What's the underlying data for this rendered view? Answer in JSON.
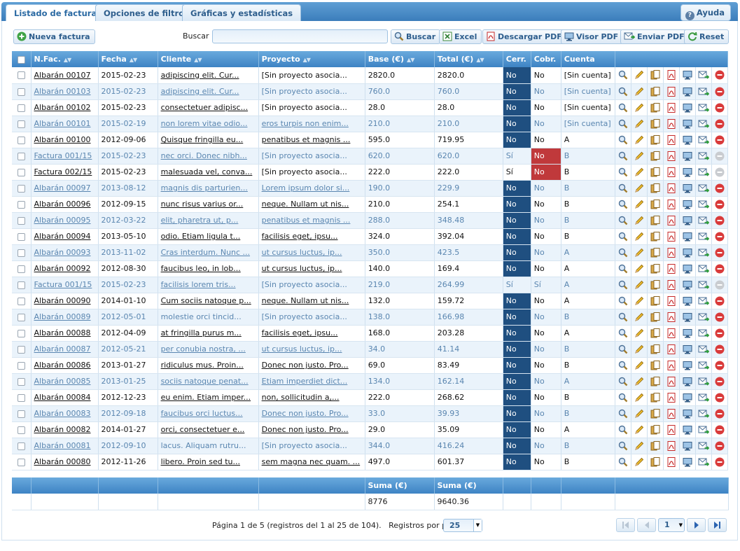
{
  "tabs": [
    {
      "label": "Listado de facturas",
      "active": true
    },
    {
      "label": "Opciones de filtro",
      "active": false
    },
    {
      "label": "Gráficas y estadísticas",
      "active": false
    }
  ],
  "help_label": "Ayuda",
  "toolbar": {
    "new_invoice": "Nueva factura",
    "search_label": "Buscar",
    "search_value": "",
    "search_button": "Buscar",
    "excel": "Excel",
    "download_pdf": "Descargar PDF",
    "viewer_pdf": "Visor PDF",
    "send_pdf": "Enviar PDF",
    "reset": "Reset"
  },
  "columns": {
    "nfac": "N.Fac.",
    "fecha": "Fecha",
    "cliente": "Cliente",
    "proyecto": "Proyecto",
    "base": "Base (€)",
    "total": "Total (€)",
    "cerr": "Cerr.",
    "cobr": "Cobr.",
    "cuenta": "Cuenta"
  },
  "rows": [
    {
      "nfac": "Albarán 00107",
      "fecha": "2015-02-23",
      "cliente": "adipiscing elit. Cur...",
      "proyecto": "[Sin proyecto asocia...",
      "base": "2820.0",
      "total": "2820.0",
      "cerr": "No",
      "cobr": "No",
      "cuenta": "[Sin cuenta]"
    },
    {
      "nfac": "Albarán 00103",
      "fecha": "2015-02-23",
      "cliente": "adipiscing elit. Cur...",
      "proyecto": "[Sin proyecto asocia...",
      "base": "760.0",
      "total": "760.0",
      "cerr": "No",
      "cobr": "No",
      "cuenta": "[Sin cuenta]"
    },
    {
      "nfac": "Albarán 00102",
      "fecha": "2015-02-23",
      "cliente": "consectetuer adipisc...",
      "proyecto": "[Sin proyecto asocia...",
      "base": "28.0",
      "total": "28.0",
      "cerr": "No",
      "cobr": "No",
      "cuenta": "[Sin cuenta]"
    },
    {
      "nfac": "Albarán 00101",
      "fecha": "2015-02-19",
      "cliente": "non lorem vitae odio...",
      "proyecto": "eros turpis non enim...",
      "base": "210.0",
      "total": "210.0",
      "cerr": "No",
      "cobr": "No",
      "cuenta": "[Sin cuenta]"
    },
    {
      "nfac": "Albarán 00100",
      "fecha": "2012-09-06",
      "cliente": "Quisque fringilla eu...",
      "proyecto": "penatibus et magnis ...",
      "base": "595.0",
      "total": "719.95",
      "cerr": "No",
      "cobr": "No",
      "cuenta": "A"
    },
    {
      "nfac": "Factura 001/15",
      "fecha": "2015-02-23",
      "cliente": "nec orci. Donec nibh...",
      "proyecto": "[Sin proyecto asocia...",
      "base": "620.0",
      "total": "620.0",
      "cerr": "Sí",
      "cobr": "No",
      "cuenta": "B",
      "cobr_red": true,
      "delete_disabled": true
    },
    {
      "nfac": "Factura 002/15",
      "fecha": "2015-02-23",
      "cliente": "malesuada vel, conva...",
      "proyecto": "[Sin proyecto asocia...",
      "base": "222.0",
      "total": "222.0",
      "cerr": "Sí",
      "cobr": "No",
      "cuenta": "B",
      "cobr_red": true,
      "delete_disabled": true
    },
    {
      "nfac": "Albarán 00097",
      "fecha": "2013-08-12",
      "cliente": "magnis dis parturien...",
      "proyecto": "Lorem ipsum dolor si...",
      "base": "190.0",
      "total": "229.9",
      "cerr": "No",
      "cobr": "No",
      "cuenta": "B"
    },
    {
      "nfac": "Albarán 00096",
      "fecha": "2012-09-15",
      "cliente": "nunc risus varius or...",
      "proyecto": "neque. Nullam ut nis...",
      "base": "210.0",
      "total": "254.1",
      "cerr": "No",
      "cobr": "No",
      "cuenta": "B"
    },
    {
      "nfac": "Albarán 00095",
      "fecha": "2012-03-22",
      "cliente": "elit, pharetra ut, p...",
      "proyecto": "penatibus et magnis ...",
      "base": "288.0",
      "total": "348.48",
      "cerr": "No",
      "cobr": "No",
      "cuenta": "B"
    },
    {
      "nfac": "Albarán 00094",
      "fecha": "2013-05-10",
      "cliente": "odio. Etiam ligula t...",
      "proyecto": "facilisis eget, ipsu...",
      "base": "324.0",
      "total": "392.04",
      "cerr": "No",
      "cobr": "No",
      "cuenta": "B"
    },
    {
      "nfac": "Albarán 00093",
      "fecha": "2013-11-02",
      "cliente": "Cras interdum. Nunc ...",
      "proyecto": "ut cursus luctus, ip...",
      "base": "350.0",
      "total": "423.5",
      "cerr": "No",
      "cobr": "No",
      "cuenta": "A"
    },
    {
      "nfac": "Albarán 00092",
      "fecha": "2012-08-30",
      "cliente": "faucibus leo, in lob...",
      "proyecto": "ut cursus luctus, ip...",
      "base": "140.0",
      "total": "169.4",
      "cerr": "No",
      "cobr": "No",
      "cuenta": "A"
    },
    {
      "nfac": "Factura 001/15",
      "fecha": "2015-02-23",
      "cliente": "facilisis lorem tris...",
      "proyecto": "[Sin proyecto asocia...",
      "base": "219.0",
      "total": "264.99",
      "cerr": "Sí",
      "cobr": "Sí",
      "cuenta": "A",
      "delete_disabled": true
    },
    {
      "nfac": "Albarán 00090",
      "fecha": "2014-01-10",
      "cliente": "Cum sociis natoque p...",
      "proyecto": "neque. Nullam ut nis...",
      "base": "132.0",
      "total": "159.72",
      "cerr": "No",
      "cobr": "No",
      "cuenta": "A"
    },
    {
      "nfac": "Albarán 00089",
      "fecha": "2012-05-01",
      "cliente": "molestie orci tincid...",
      "proyecto": "[Sin proyecto asocia...",
      "base": "138.0",
      "total": "166.98",
      "cerr": "No",
      "cobr": "No",
      "cuenta": "B",
      "cliente_plain": true
    },
    {
      "nfac": "Albarán 00088",
      "fecha": "2012-04-09",
      "cliente": "at fringilla purus m...",
      "proyecto": "facilisis eget, ipsu...",
      "base": "168.0",
      "total": "203.28",
      "cerr": "No",
      "cobr": "No",
      "cuenta": "A"
    },
    {
      "nfac": "Albarán 00087",
      "fecha": "2012-05-21",
      "cliente": "per conubia nostra, ...",
      "proyecto": "ut cursus luctus, ip...",
      "base": "34.0",
      "total": "41.14",
      "cerr": "No",
      "cobr": "No",
      "cuenta": "B"
    },
    {
      "nfac": "Albarán 00086",
      "fecha": "2013-01-27",
      "cliente": "ridiculus mus. Proin...",
      "proyecto": "Donec non justo. Pro...",
      "base": "69.0",
      "total": "83.49",
      "cerr": "No",
      "cobr": "No",
      "cuenta": "B"
    },
    {
      "nfac": "Albarán 00085",
      "fecha": "2013-01-25",
      "cliente": "sociis natoque penat...",
      "proyecto": "Etiam imperdiet dict...",
      "base": "134.0",
      "total": "162.14",
      "cerr": "No",
      "cobr": "No",
      "cuenta": "A"
    },
    {
      "nfac": "Albarán 00084",
      "fecha": "2012-12-23",
      "cliente": "eu enim. Etiam imper...",
      "proyecto": "non, sollicitudin a,...",
      "base": "222.0",
      "total": "268.62",
      "cerr": "No",
      "cobr": "No",
      "cuenta": "B"
    },
    {
      "nfac": "Albarán 00083",
      "fecha": "2012-09-18",
      "cliente": "faucibus orci luctus...",
      "proyecto": "Donec non justo. Pro...",
      "base": "33.0",
      "total": "39.93",
      "cerr": "No",
      "cobr": "No",
      "cuenta": "B"
    },
    {
      "nfac": "Albarán 00082",
      "fecha": "2014-01-27",
      "cliente": "orci, consectetuer e...",
      "proyecto": "Donec non justo. Pro...",
      "base": "29.0",
      "total": "35.09",
      "cerr": "No",
      "cobr": "No",
      "cuenta": "A"
    },
    {
      "nfac": "Albarán 00081",
      "fecha": "2012-09-10",
      "cliente": "lacus. Aliquam rutru...",
      "proyecto": "[Sin proyecto asocia...",
      "base": "344.0",
      "total": "416.24",
      "cerr": "No",
      "cobr": "No",
      "cuenta": "B",
      "cliente_plain": true
    },
    {
      "nfac": "Albarán 00080",
      "fecha": "2012-11-26",
      "cliente": "libero. Proin sed tu...",
      "proyecto": "sem magna nec quam. ...",
      "base": "497.0",
      "total": "601.37",
      "cerr": "No",
      "cobr": "No",
      "cuenta": "B"
    }
  ],
  "summary": {
    "base_label": "Suma (€)",
    "total_label": "Suma (€)",
    "base_value": "8776",
    "total_value": "9640.36"
  },
  "pager": {
    "info": "Página 1 de 5 (registros del 1 al 25 de 104).",
    "per_page_label": "Registros por página:",
    "per_page_value": "25",
    "page_value": "1"
  },
  "colors": {
    "header_blue": "#3d83c4",
    "closed_no": "#1f4f80",
    "unpaid_red": "#c0393b"
  },
  "icons": {
    "row_actions": [
      "view-icon",
      "edit-icon",
      "copy-icon",
      "pdf-icon",
      "monitor-icon",
      "send-icon",
      "delete-icon"
    ]
  }
}
